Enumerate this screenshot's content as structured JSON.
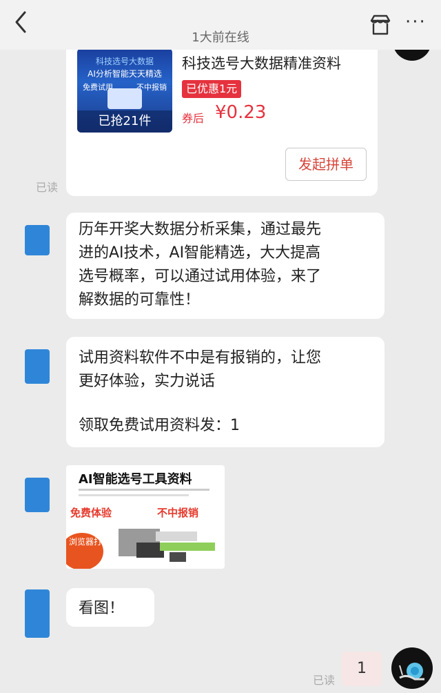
{
  "header": {
    "subtitle": "1大前在线"
  },
  "product_card": {
    "image": {
      "line1": "科技选号大数据",
      "line2": "AI分析智能天天精选",
      "tag_left": "免费试用",
      "tag_right": "不中报销",
      "sold": "已抢21件"
    },
    "title": "科技选号大数据精准资料",
    "coupon": "已优惠1元",
    "price_label": "券后",
    "price": "¥0.23",
    "button": "发起拼单",
    "read_status": "已读"
  },
  "messages": [
    {
      "lines": [
        "历年开奖大数据分析采集，通过最先",
        "进的AI技术，AI智能精选，大大提高",
        "选号概率，可以通过试用体验，来了",
        "解数据的可靠性！"
      ]
    },
    {
      "lines": [
        "试用资料软件不中是有报销的，让您",
        "更好体验，实力说话",
        "",
        "领取免费试用资料发：1"
      ]
    }
  ],
  "image_message": {
    "title": "AI智能选号工具资料",
    "left_text": "免费体验",
    "right_text": "不中报销",
    "badge": "浏览器打开"
  },
  "last_message": {
    "text": "看图！"
  },
  "reply": {
    "read_status": "已读",
    "text": "1"
  },
  "colors": {
    "accent_red": "#e5323e",
    "avatar_blue": "#2f86d8",
    "background": "#ebebeb"
  }
}
